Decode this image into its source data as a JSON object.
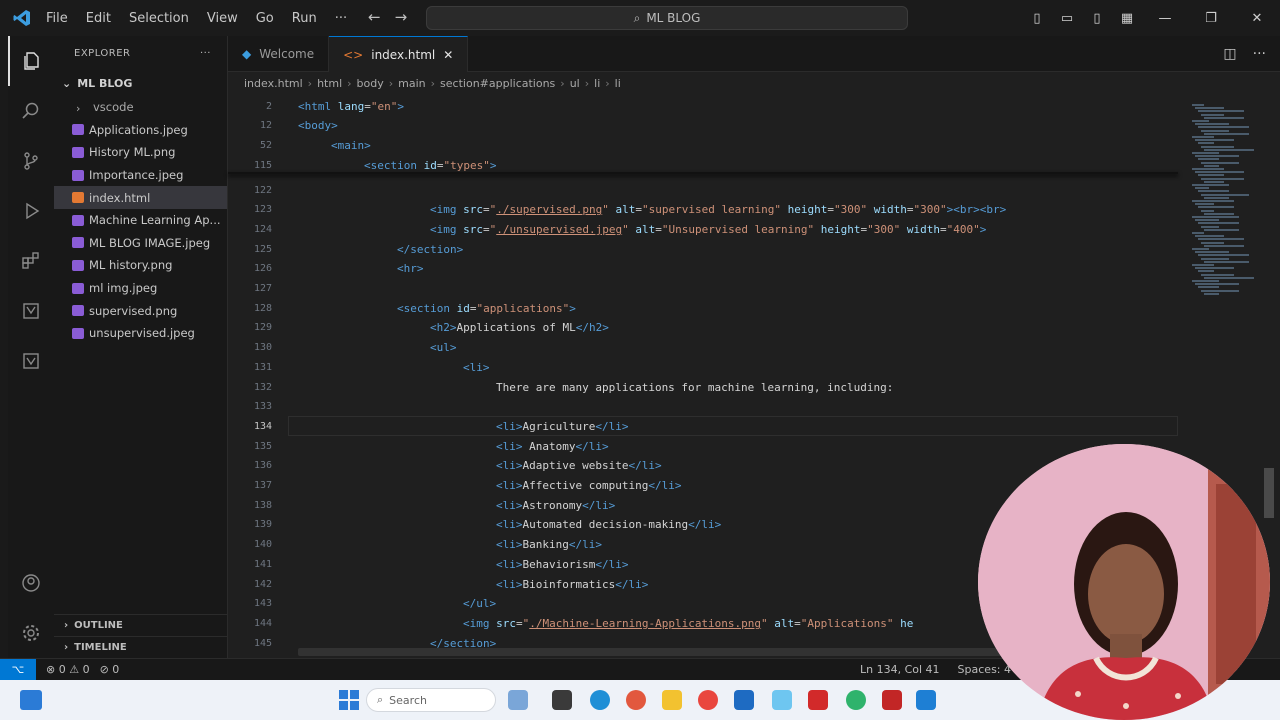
{
  "titlebar": {
    "menu": [
      "File",
      "Edit",
      "Selection",
      "View",
      "Go",
      "Run",
      "···"
    ],
    "search_text": "ML BLOG",
    "window_controls": [
      "—",
      "❐",
      "✕"
    ]
  },
  "sidebar": {
    "header": "EXPLORER",
    "root": "ML BLOG",
    "items": [
      {
        "label": "vscode",
        "kind": "folder"
      },
      {
        "label": "Applications.jpeg",
        "kind": "image"
      },
      {
        "label": "History ML.png",
        "kind": "image"
      },
      {
        "label": "Importance.jpeg",
        "kind": "image"
      },
      {
        "label": "index.html",
        "kind": "html",
        "selected": true
      },
      {
        "label": "Machine Learning Ap...",
        "kind": "image"
      },
      {
        "label": "ML BLOG IMAGE.jpeg",
        "kind": "image"
      },
      {
        "label": "ML history.png",
        "kind": "image"
      },
      {
        "label": "ml img.jpeg",
        "kind": "image"
      },
      {
        "label": "supervised.png",
        "kind": "image"
      },
      {
        "label": "unsupervised.jpeg",
        "kind": "image"
      }
    ],
    "outline": "OUTLINE",
    "timeline": "TIMELINE"
  },
  "tabs": [
    {
      "label": "Welcome",
      "active": false
    },
    {
      "label": "index.html",
      "active": true
    }
  ],
  "breadcrumb": [
    "index.html",
    "html",
    "body",
    "main",
    "section#applications",
    "ul",
    "li",
    "li"
  ],
  "code": {
    "sticky": [
      {
        "n": "2",
        "html": "<span class='tag'>&lt;html</span> <span class='att'>lang</span>=<span class='str'>\"en\"</span><span class='tag'>&gt;</span>",
        "indent": 0
      },
      {
        "n": "12",
        "html": "<span class='tag'>&lt;body&gt;</span>",
        "indent": 0
      },
      {
        "n": "52",
        "html": "<span class='tag'>&lt;main&gt;</span>",
        "indent": 1
      },
      {
        "n": "115",
        "html": "<span class='tag'>&lt;section</span> <span class='att'>id</span>=<span class='str'>\"types\"</span><span class='tag'>&gt;</span>",
        "indent": 2
      }
    ],
    "lines": [
      {
        "n": "122",
        "html": "",
        "indent": 0
      },
      {
        "n": "123",
        "html": "<span class='tag'>&lt;img</span> <span class='att'>src</span>=<span class='str'>\"</span><span class='link'>./supervised.png</span><span class='str'>\"</span> <span class='att'>alt</span>=<span class='str'>\"supervised learning\"</span> <span class='att'>height</span>=<span class='str'>\"300\"</span> <span class='att'>width</span>=<span class='str'>\"300\"</span><span class='tag'>&gt;&lt;br&gt;&lt;br&gt;</span>",
        "indent": 4
      },
      {
        "n": "124",
        "html": "<span class='tag'>&lt;img</span> <span class='att'>src</span>=<span class='str'>\"</span><span class='link'>./unsupervised.jpeg</span><span class='str'>\"</span> <span class='att'>alt</span>=<span class='str'>\"Unsupervised learning\"</span> <span class='att'>height</span>=<span class='str'>\"300\"</span> <span class='att'>width</span>=<span class='str'>\"400\"</span><span class='tag'>&gt;</span>",
        "indent": 4
      },
      {
        "n": "125",
        "html": "<span class='tag'>&lt;/section&gt;</span>",
        "indent": 3
      },
      {
        "n": "126",
        "html": "<span class='tag'>&lt;hr&gt;</span>",
        "indent": 3
      },
      {
        "n": "127",
        "html": "",
        "indent": 0
      },
      {
        "n": "128",
        "html": "<span class='tag'>&lt;section</span> <span class='att'>id</span>=<span class='str'>\"applications\"</span><span class='tag'>&gt;</span>",
        "indent": 3
      },
      {
        "n": "129",
        "html": "<span class='tag'>&lt;h2&gt;</span><span class='plain'>Applications of ML</span><span class='tag'>&lt;/h2&gt;</span>",
        "indent": 4
      },
      {
        "n": "130",
        "html": "<span class='tag'>&lt;ul&gt;</span>",
        "indent": 4
      },
      {
        "n": "131",
        "html": "<span class='tag'>&lt;li&gt;</span>",
        "indent": 5
      },
      {
        "n": "132",
        "html": "<span class='plain'>There are many applications for machine learning, including:</span>",
        "indent": 6
      },
      {
        "n": "133",
        "html": "",
        "indent": 0
      },
      {
        "n": "134",
        "html": "<span class='tag'>&lt;li&gt;</span><span class='plain'>Agriculture</span><span class='tag'>&lt;/li&gt;</span>",
        "indent": 6,
        "current": true
      },
      {
        "n": "135",
        "html": "<span class='tag'>&lt;li&gt;</span> <span class='plain'>Anatomy</span><span class='tag'>&lt;/li&gt;</span>",
        "indent": 6
      },
      {
        "n": "136",
        "html": "<span class='tag'>&lt;li&gt;</span><span class='plain'>Adaptive website</span><span class='tag'>&lt;/li&gt;</span>",
        "indent": 6
      },
      {
        "n": "137",
        "html": "<span class='tag'>&lt;li&gt;</span><span class='plain'>Affective computing</span><span class='tag'>&lt;/li&gt;</span>",
        "indent": 6
      },
      {
        "n": "138",
        "html": "<span class='tag'>&lt;li&gt;</span><span class='plain'>Astronomy</span><span class='tag'>&lt;/li&gt;</span>",
        "indent": 6
      },
      {
        "n": "139",
        "html": "<span class='tag'>&lt;li&gt;</span><span class='plain'>Automated decision-making</span><span class='tag'>&lt;/li&gt;</span>",
        "indent": 6
      },
      {
        "n": "140",
        "html": "<span class='tag'>&lt;li&gt;</span><span class='plain'>Banking</span><span class='tag'>&lt;/li&gt;</span>",
        "indent": 6
      },
      {
        "n": "141",
        "html": "<span class='tag'>&lt;li&gt;</span><span class='plain'>Behaviorism</span><span class='tag'>&lt;/li&gt;</span>",
        "indent": 6
      },
      {
        "n": "142",
        "html": "<span class='tag'>&lt;li&gt;</span><span class='plain'>Bioinformatics</span><span class='tag'>&lt;/li&gt;</span>",
        "indent": 6
      },
      {
        "n": "143",
        "html": "<span class='tag'>&lt;/ul&gt;</span>",
        "indent": 5
      },
      {
        "n": "144",
        "html": "<span class='tag'>&lt;img</span> <span class='att'>src</span>=<span class='str'>\"</span><span class='link'>./Machine-Learning-Applications.png</span><span class='str'>\"</span> <span class='att'>alt</span>=<span class='str'>\"Applications\"</span> <span class='att'>he</span>",
        "indent": 5
      },
      {
        "n": "145",
        "html": "<span class='tag'>&lt;/section&gt;</span>",
        "indent": 4
      }
    ]
  },
  "statusbar": {
    "remote": "⌥",
    "left": [
      "⊗ 0 ⚠ 0",
      "⊘ 0"
    ],
    "right": [
      "Ln 134, Col 41",
      "Spaces: 4"
    ]
  },
  "taskbar": {
    "search_placeholder": "Search"
  },
  "colors": {
    "accent": "#0078d4",
    "tag": "#569cd6",
    "attr": "#9cdcfe",
    "string": "#ce9178"
  }
}
